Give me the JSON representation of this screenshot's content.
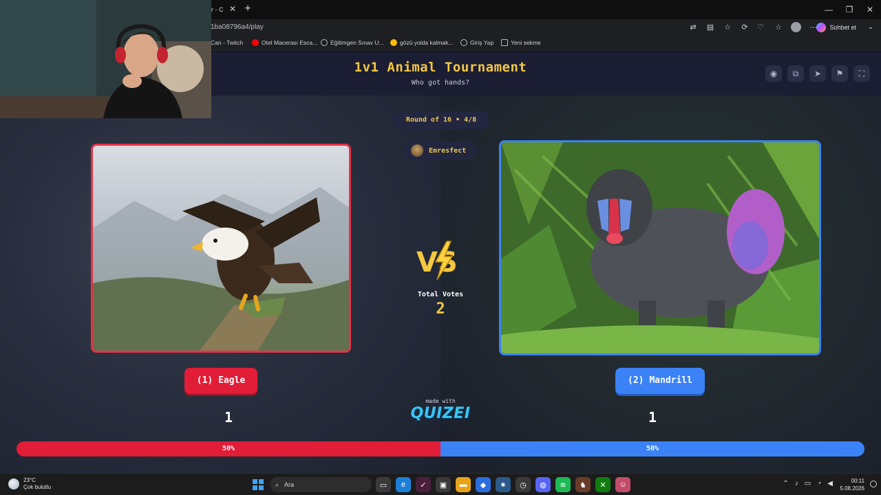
{
  "browser": {
    "tab_label": "dir - C",
    "tab_close": "✕",
    "new_tab": "+",
    "window_controls": [
      "—",
      "❐",
      "✕"
    ],
    "url": "1ba08796a4/play",
    "copilot_label": "Sohbet et",
    "bookmarks": [
      {
        "label": "Can - Twitch",
        "icon": "twitch-icon",
        "color": "#9146ff"
      },
      {
        "label": "Otel Macerası Esca...",
        "icon": "youtube-icon",
        "color": "#ff0000"
      },
      {
        "label": "Eğitimgen Sınav U...",
        "icon": "globe-icon",
        "color": "#9aa0a6"
      },
      {
        "label": "gözü yolda kalmak...",
        "icon": "google-icon",
        "color": "#fbbc05"
      },
      {
        "label": "Giriş Yap",
        "icon": "globe-icon",
        "color": "#9aa0a6"
      },
      {
        "label": "Yeni sekme",
        "icon": "page-icon",
        "color": "#9aa0a6"
      }
    ]
  },
  "header": {
    "title": "1v1 Animal Tournament",
    "subtitle": "Who got hands?",
    "actions": [
      "eye-icon",
      "share-icon",
      "send-icon",
      "flag-icon",
      "fullscreen-icon"
    ]
  },
  "round": {
    "label": "Round of 16 • 4/8"
  },
  "user": {
    "name": "Emresfect"
  },
  "center": {
    "vs": "VS",
    "total_votes_label": "Total Votes",
    "total_votes": "2",
    "made_with": "made with",
    "brand": "QUIZEI"
  },
  "left": {
    "choice_label": "(1) Eagle",
    "votes": "1",
    "percent_label": "50%",
    "percent": 50,
    "color": "#e11d37"
  },
  "right": {
    "choice_label": "(2) Mandrill",
    "votes": "1",
    "percent_label": "50%",
    "percent": 50,
    "color": "#3b82f6"
  },
  "taskbar": {
    "temperature": "23°C",
    "weather": "Çok bulutlu",
    "search_placeholder": "Ara",
    "time": "00:11",
    "date": "5.08.2026"
  }
}
